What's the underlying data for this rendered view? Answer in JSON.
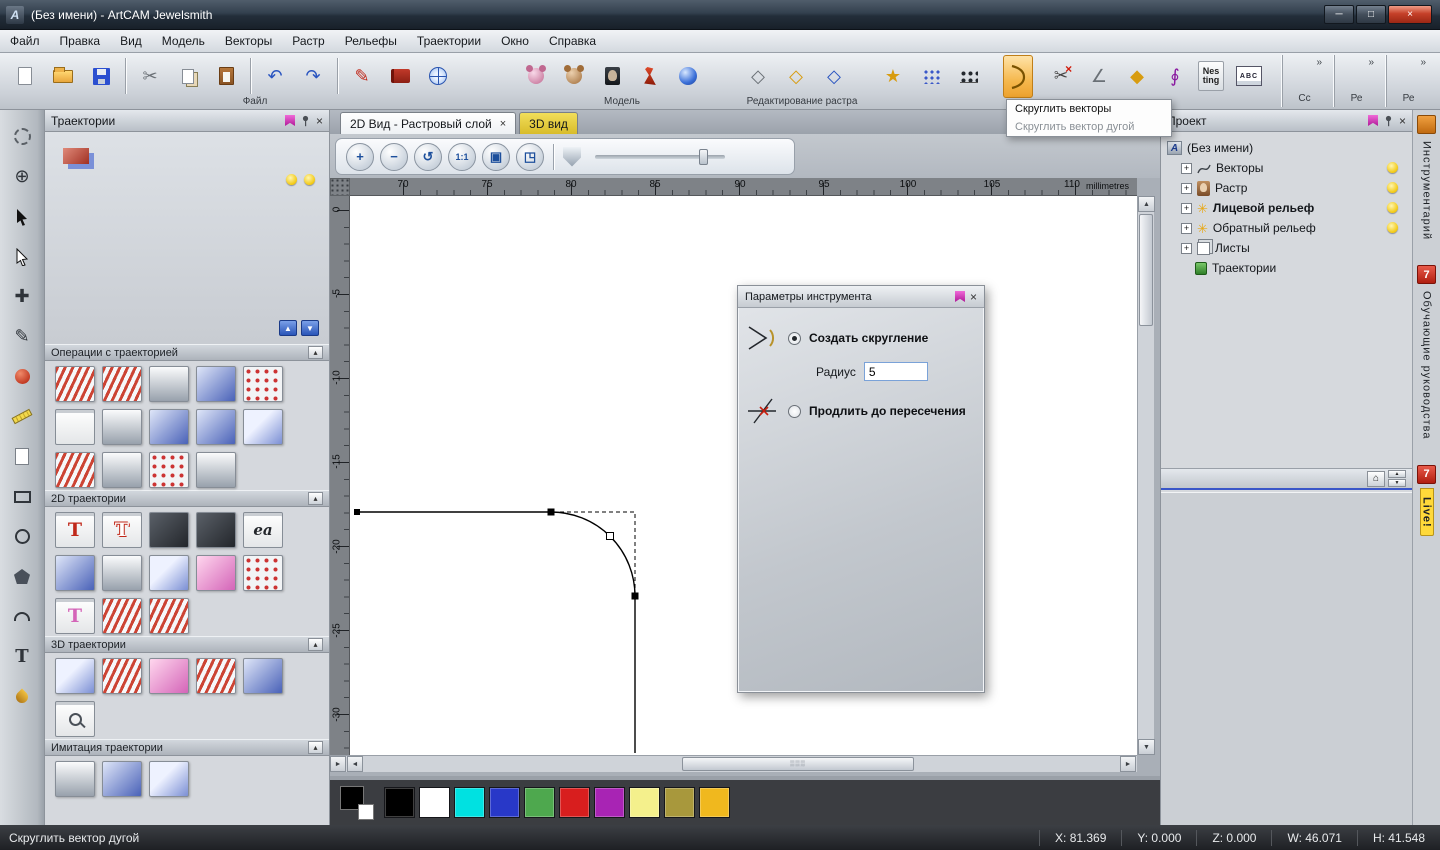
{
  "window": {
    "title": "(Без имени) - ArtCAM Jewelsmith"
  },
  "menu": {
    "items": [
      "Файл",
      "Правка",
      "Вид",
      "Модель",
      "Векторы",
      "Растр",
      "Рельефы",
      "Траектории",
      "Окно",
      "Справка"
    ]
  },
  "toolbar": {
    "group_labels": [
      "Файл",
      "Модель",
      "Редактирование растра"
    ],
    "overflow_labels": [
      "Сс",
      "Ре",
      "Ре"
    ],
    "nesting_label": "Nes ting",
    "ocr_label": "ABC"
  },
  "fillet_menu": {
    "items": [
      "Скруглить векторы",
      "Скруглить вектор дугой"
    ]
  },
  "toolpaths_panel": {
    "title": "Траектории",
    "sections": [
      "Операции с траекторией",
      "2D траектории",
      "3D траектории",
      "Имитация траектории"
    ]
  },
  "canvas": {
    "tabs": [
      "2D Вид - Растровый слой",
      "3D вид"
    ],
    "zoom_ratio": "1:1",
    "h_ticks": [
      "70",
      "75",
      "80",
      "85",
      "90",
      "95",
      "100",
      "105",
      "110"
    ],
    "unit": "millimetres",
    "v_ticks": [
      "0",
      "-5",
      "-10",
      "-15",
      "-20",
      "-25",
      "-30"
    ]
  },
  "tool_dialog": {
    "title": "Параметры инструмента",
    "option_create": "Создать скругление",
    "radius_label": "Радиус",
    "radius_value": "5",
    "option_extend": "Продлить до пересечения"
  },
  "project_panel": {
    "title": "Проект",
    "items": [
      "(Без имени)",
      "Векторы",
      "Растр",
      "Лицевой рельеф",
      "Обратный рельеф",
      "Листы",
      "Траектории"
    ]
  },
  "side_tabs": [
    "Инструментарий",
    "Обучающие руководства",
    "Live!"
  ],
  "palette": {
    "swatches": [
      "#000000",
      "#ffffff",
      "#00e1e1",
      "#2838c8",
      "#4ea84e",
      "#d81e1e",
      "#a824b4",
      "#f4f08c",
      "#a8983c",
      "#f0b81e"
    ]
  },
  "status": {
    "message": "Скруглить вектор дугой",
    "coords": [
      "X: 81.369",
      "Y: 0.000",
      "Z: 0.000",
      "W: 46.071",
      "H: 41.548"
    ]
  }
}
